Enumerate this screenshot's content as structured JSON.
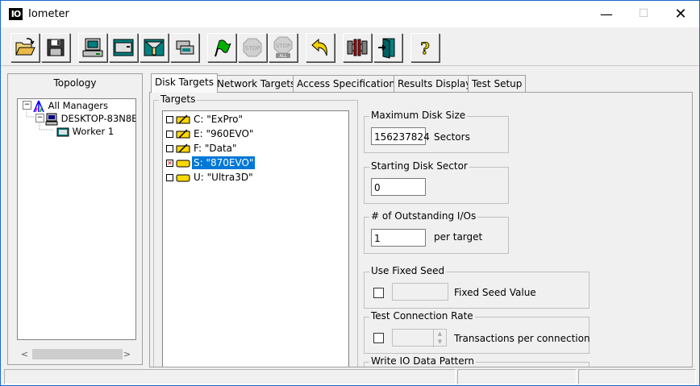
{
  "window": {
    "title": "Iometer",
    "icon_text": "IO",
    "minimize": "—",
    "maximize": "☐",
    "close": "✕"
  },
  "toolbar": {
    "buttons": [
      {
        "name": "open-config-button",
        "icon": "open-folder-icon"
      },
      {
        "name": "save-config-button",
        "icon": "save-disk-icon"
      },
      {
        "name": "start-display-manager-button",
        "icon": "computer-icon"
      },
      {
        "name": "start-disk-worker-button",
        "icon": "disk-worker-icon"
      },
      {
        "name": "start-network-worker-button",
        "icon": "network-worker-icon"
      },
      {
        "name": "duplicate-worker-button",
        "icon": "duplicate-worker-icon"
      },
      {
        "name": "start-tests-button",
        "icon": "green-flag-icon"
      },
      {
        "name": "stop-button",
        "icon": "stop-sign-icon",
        "label": "STOP"
      },
      {
        "name": "stop-all-button",
        "icon": "stop-all-icon",
        "label": "STOP",
        "sublabel": "ALL"
      },
      {
        "name": "reset-workers-button",
        "icon": "undo-arrow-icon"
      },
      {
        "name": "disconnect-manager-button",
        "icon": "disconnect-icon"
      },
      {
        "name": "exit-button",
        "icon": "exit-door-icon"
      },
      {
        "name": "help-button",
        "icon": "help-question-icon",
        "label": "?"
      }
    ]
  },
  "topology": {
    "title": "Topology",
    "tree": [
      {
        "label": "All Managers"
      },
      {
        "label": "DESKTOP-83N8E"
      },
      {
        "label": "Worker 1"
      }
    ]
  },
  "tabs": [
    {
      "label": "Disk Targets",
      "active": true
    },
    {
      "label": "Network Targets"
    },
    {
      "label": "Access Specifications"
    },
    {
      "label": "Results Display"
    },
    {
      "label": "Test Setup"
    }
  ],
  "targets": {
    "group_label": "Targets",
    "items": [
      {
        "label": "C: \"ExPro\"",
        "checked": false,
        "selected": false
      },
      {
        "label": "E: \"960EVO\"",
        "checked": false,
        "selected": false
      },
      {
        "label": "F: \"Data\"",
        "checked": false,
        "selected": false
      },
      {
        "label": "S: \"870EVO\"",
        "checked": true,
        "selected": true
      },
      {
        "label": "U: \"Ultra3D\"",
        "checked": false,
        "selected": false
      }
    ],
    "checked_mark": "✕"
  },
  "max_disk_size": {
    "label": "Maximum Disk Size",
    "value": "156237824",
    "unit": "Sectors"
  },
  "starting_sector": {
    "label": "Starting Disk Sector",
    "value": "0"
  },
  "outstanding_ios": {
    "label": "# of Outstanding I/Os",
    "value": "1",
    "unit": "per target"
  },
  "fixed_seed": {
    "label": "Use Fixed Seed",
    "field_label": "Fixed Seed Value",
    "value": ""
  },
  "test_connection_rate": {
    "label": "Test Connection Rate",
    "field_label": "Transactions per connection",
    "value": ""
  },
  "write_io_pattern": {
    "label": "Write IO Data Pattern"
  },
  "colors": {
    "selection": "#0078d7",
    "window_border": "#1b6ac9",
    "face": "#f0f0f0"
  }
}
